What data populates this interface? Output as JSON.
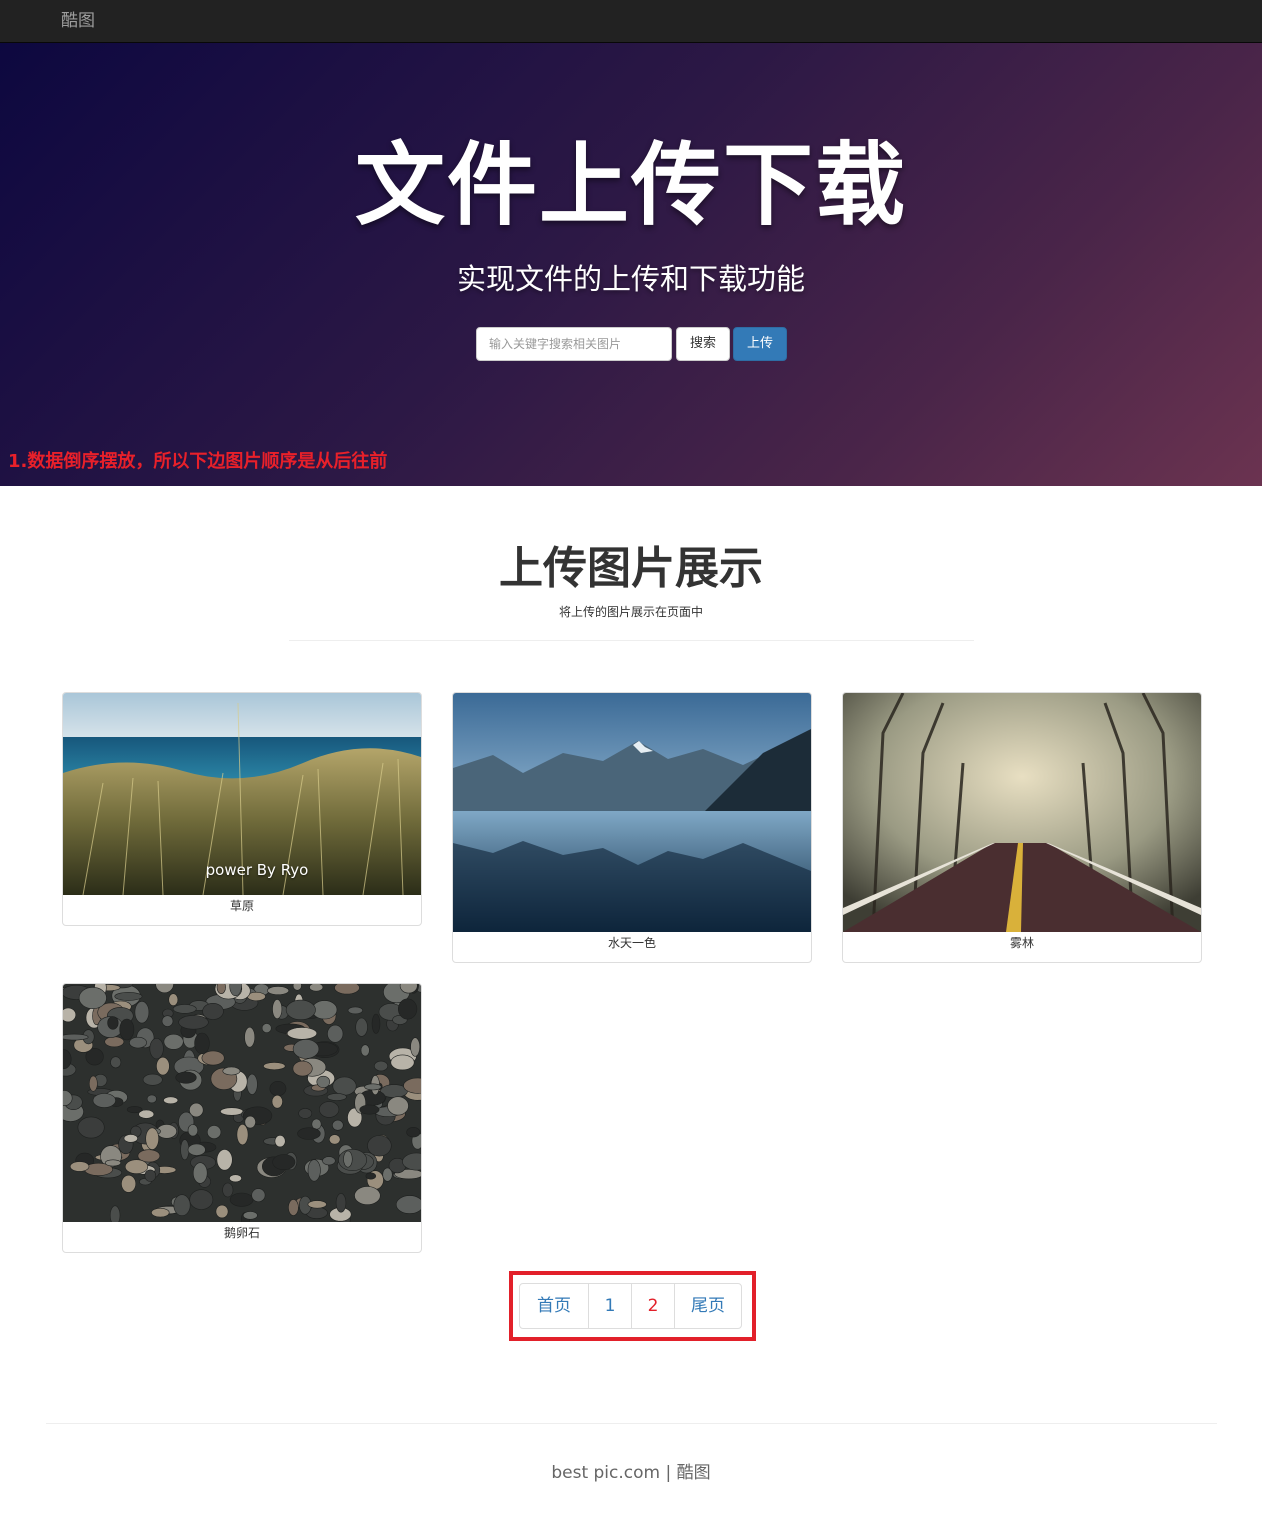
{
  "navbar": {
    "brand": "酷图"
  },
  "hero": {
    "title": "文件上传下载",
    "subtitle": "实现文件的上传和下载功能",
    "search_placeholder": "输入关键字搜索相关图片",
    "search_label": "搜索",
    "upload_label": "上传",
    "note": "1.数据倒序摆放，所以下边图片顺序是从后往前"
  },
  "gallery": {
    "title": "上传图片展示",
    "subtitle": "将上传的图片展示在页面中",
    "items": [
      {
        "caption": "草原",
        "watermark": "power By Ryo"
      },
      {
        "caption": "水天一色"
      },
      {
        "caption": "雾林"
      },
      {
        "caption": "鹅卵石"
      }
    ]
  },
  "pagination": {
    "first": "首页",
    "pages": [
      "1",
      "2"
    ],
    "current": "2",
    "last": "尾页"
  },
  "footer": {
    "text": "best pic.com | 酷图"
  },
  "colors": {
    "accent": "#337ab7",
    "highlight": "#e2202a",
    "navbar": "#222222"
  }
}
